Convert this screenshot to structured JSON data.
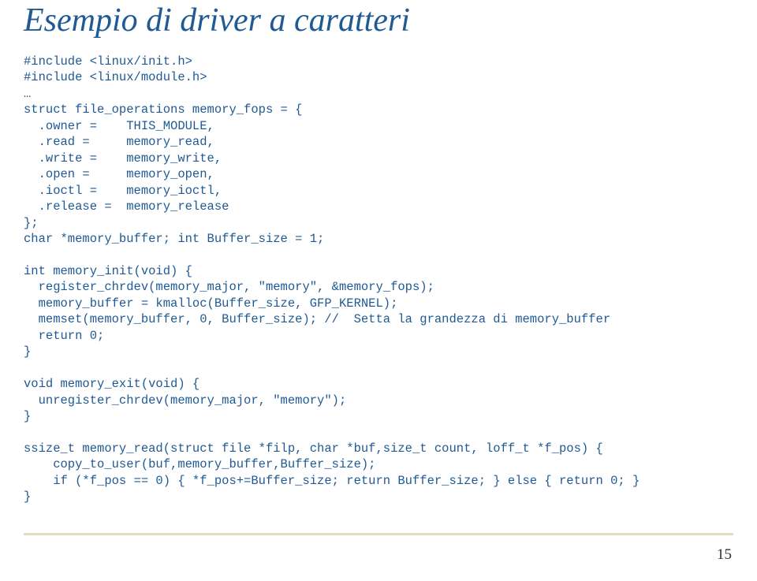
{
  "title": "Esempio di driver a caratteri",
  "code": "#include <linux/init.h>\n#include <linux/module.h>\n…\nstruct file_operations memory_fops = {\n  .owner =    THIS_MODULE,\n  .read =     memory_read,\n  .write =    memory_write,\n  .open =     memory_open,\n  .ioctl =    memory_ioctl,\n  .release =  memory_release\n};\nchar *memory_buffer; int Buffer_size = 1;\n\nint memory_init(void) {\n  register_chrdev(memory_major, \"memory\", &memory_fops);\n  memory_buffer = kmalloc(Buffer_size, GFP_KERNEL);\n  memset(memory_buffer, 0, Buffer_size); //  Setta la grandezza di memory_buffer\n  return 0;\n}\n\nvoid memory_exit(void) {\n  unregister_chrdev(memory_major, \"memory\");\n}\n\nssize_t memory_read(struct file *filp, char *buf,size_t count, loff_t *f_pos) {\n    copy_to_user(buf,memory_buffer,Buffer_size);\n    if (*f_pos == 0) { *f_pos+=Buffer_size; return Buffer_size; } else { return 0; }\n}",
  "page_number": "15"
}
